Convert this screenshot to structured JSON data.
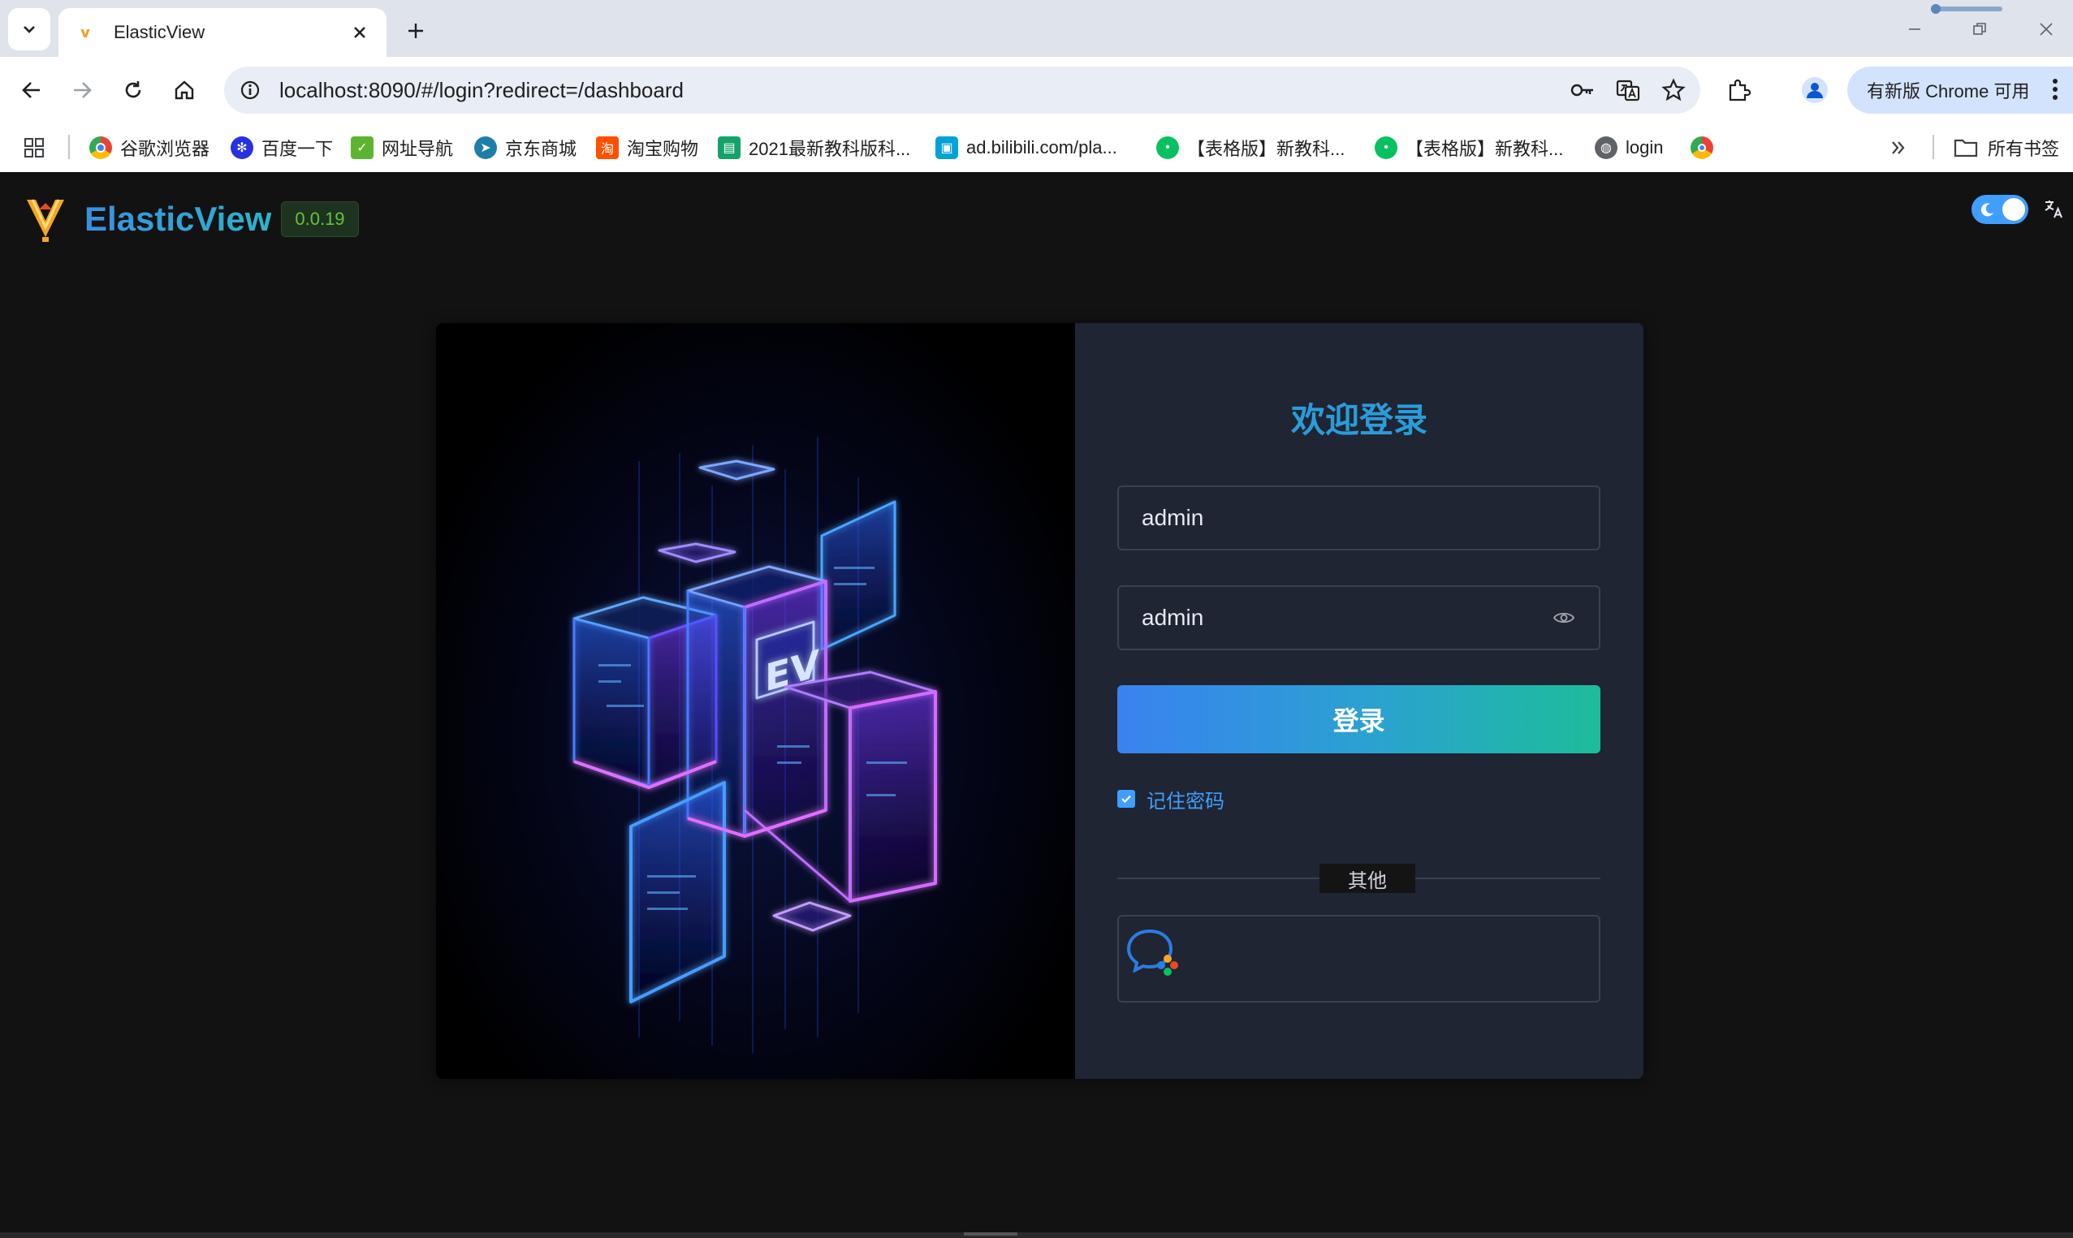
{
  "browser": {
    "tab_title": "ElasticView",
    "url": "localhost:8090/#/login?redirect=/dashboard",
    "update_button": "有新版 Chrome 可用",
    "bookmarks": [
      {
        "label": "谷歌浏览器",
        "icon": "chrome-icon",
        "color": "#4285f4"
      },
      {
        "label": "百度一下",
        "icon": "baidu-paw-icon",
        "color": "#2932e1"
      },
      {
        "label": "网址导航",
        "icon": "hao-icon",
        "color": "#5cb531"
      },
      {
        "label": "京东商城",
        "icon": "jd-icon",
        "color": "#1d7ea8"
      },
      {
        "label": "淘宝购物",
        "icon": "taobao-icon",
        "color": "#ff5000"
      },
      {
        "label": "2021最新教科版科...",
        "icon": "doc-icon",
        "color": "#13a36a"
      },
      {
        "label": "ad.bilibili.com/pla...",
        "icon": "bilibili-icon",
        "color": "#00a1d6"
      },
      {
        "label": "【表格版】新教科...",
        "icon": "wechat-icon",
        "color": "#07c160"
      },
      {
        "label": "【表格版】新教科...",
        "icon": "wechat-icon",
        "color": "#07c160"
      },
      {
        "label": "login",
        "icon": "globe-icon",
        "color": "#5f6368"
      },
      {
        "label": "",
        "icon": "chrome-color-icon",
        "color": "#fbbc05"
      }
    ],
    "all_bookmarks": "所有书签"
  },
  "app": {
    "name": "ElasticView",
    "version": "0.0.19",
    "accent": "#409eff"
  },
  "login": {
    "welcome": "欢迎登录",
    "username": "admin",
    "password": "admin",
    "submit_label": "登录",
    "remember_label": "记住密码",
    "remember_checked": true,
    "divider_label": "其他"
  }
}
